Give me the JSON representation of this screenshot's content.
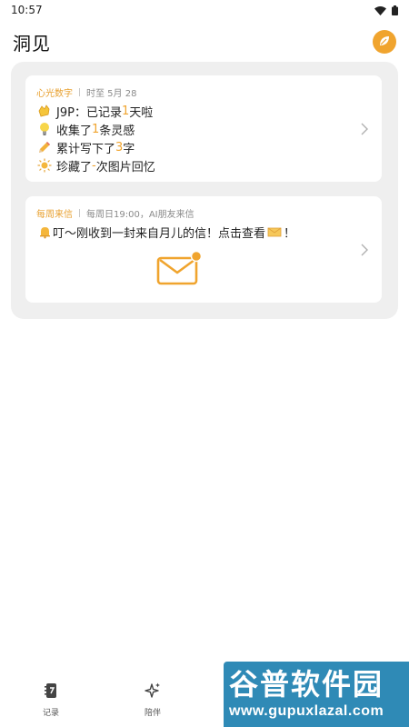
{
  "status_bar": {
    "time": "10:57",
    "icons": [
      "wifi-icon",
      "battery-icon"
    ]
  },
  "header": {
    "title": "洞见",
    "action_icon": "leaf-icon"
  },
  "cards": [
    {
      "tag": "心光数字",
      "meta": "时至 5月 28",
      "lines": [
        {
          "icon": "clap-hands-icon",
          "pre": "J9P：已记录",
          "num": "1",
          "post": "天啦"
        },
        {
          "icon": "light-bulb-icon",
          "pre": "收集了",
          "num": "1",
          "post": "条灵感"
        },
        {
          "icon": "pencil-icon",
          "pre": "累计写下了",
          "num": "3",
          "post": "字"
        },
        {
          "icon": "sun-icon",
          "pre": "珍藏了",
          "num": "-",
          "post": "次图片回忆"
        }
      ]
    },
    {
      "tag": "每周来信",
      "meta": "每周日19:00，AI朋友来信",
      "message": "叮～刚收到一封来自月儿的信！点击查看",
      "message_end": "！",
      "icons": [
        "bell-icon",
        "envelope-icon",
        "unread-dot"
      ]
    }
  ],
  "tabs": [
    {
      "label": "记录",
      "icon": "notebook-icon"
    },
    {
      "label": "陪伴",
      "icon": "sparkle-icon"
    }
  ],
  "watermark": {
    "main": "谷普软件园",
    "url": "www.gupuxlazal.com"
  },
  "colors": {
    "accent": "#F0A42E",
    "panel": "#EFEFEF",
    "watermark": "#2F8AB6"
  }
}
